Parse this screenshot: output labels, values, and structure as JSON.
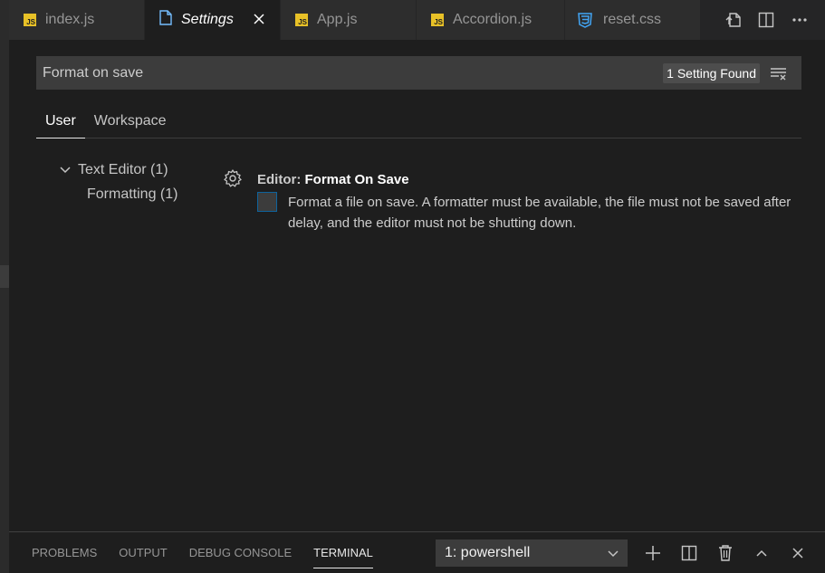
{
  "tabs": [
    {
      "label": "index.js",
      "icon": "js-file-icon",
      "active": false
    },
    {
      "label": "Settings",
      "icon": "settings-file-icon",
      "active": true
    },
    {
      "label": "App.js",
      "icon": "js-file-icon",
      "active": false
    },
    {
      "label": "Accordion.js",
      "icon": "js-file-icon",
      "active": false
    },
    {
      "label": "reset.css",
      "icon": "css-file-icon",
      "active": false
    }
  ],
  "tab_actions": [
    "open-settings-json-icon",
    "split-editor-icon",
    "more-actions-icon"
  ],
  "js_badge": "JS",
  "search": {
    "value": "Format on save",
    "result_count": "1 Setting Found"
  },
  "scope_tabs": {
    "user": "User",
    "workspace": "Workspace"
  },
  "tree": {
    "parent": "Text Editor (1)",
    "child": "Formatting (1)"
  },
  "setting": {
    "category": "Editor: ",
    "name": "Format On Save",
    "description": "Format a file on save. A formatter must be available, the file must not be saved after delay, and the editor must not be shutting down.",
    "checked": false
  },
  "panel": {
    "tabs": [
      "PROBLEMS",
      "OUTPUT",
      "DEBUG CONSOLE",
      "TERMINAL"
    ],
    "active_tab": "TERMINAL",
    "terminal_select": "1: powershell"
  },
  "colors": {
    "background": "#1e1e1e",
    "tabbar": "#252526",
    "input": "#3c3c3c",
    "focus_border": "#0e639c",
    "js_yellow": "#e8c127",
    "css_blue": "#42a5f5",
    "settings_blue": "#75beff"
  }
}
